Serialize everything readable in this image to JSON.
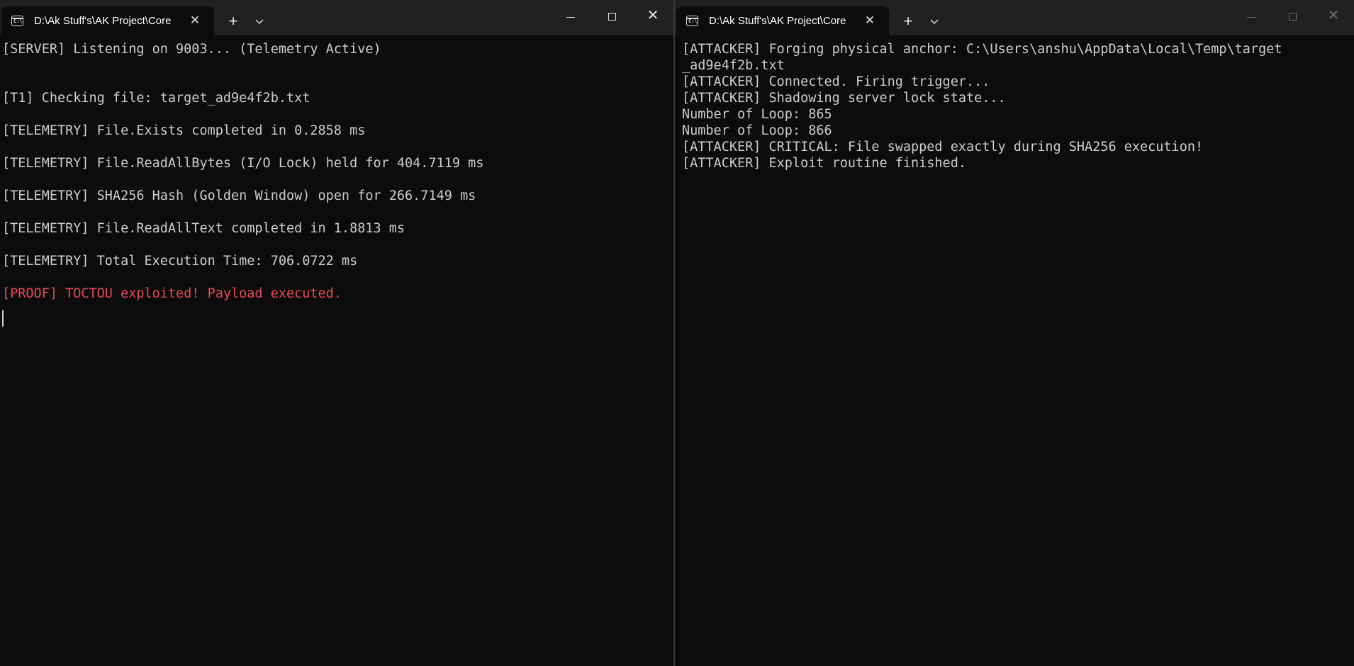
{
  "left_window": {
    "tab_title": "D:\\Ak Stuff's\\AK Project\\Core",
    "tab_close": "✕",
    "new_tab": "+",
    "dropdown": "⌄",
    "lines": [
      "[SERVER] Listening on 9003... (Telemetry Active)",
      "",
      "[T1] Checking file: target_ad9e4f2b.txt",
      "[TELEMETRY] File.Exists completed in 0.2858 ms",
      "[TELEMETRY] File.ReadAllBytes (I/O Lock) held for 404.7119 ms",
      "[TELEMETRY] SHA256 Hash (Golden Window) open for 266.7149 ms",
      "[TELEMETRY] File.ReadAllText completed in 1.8813 ms",
      "[TELEMETRY] Total Execution Time: 706.0722 ms",
      "[PROOF] TOCTOU exploited! Payload executed."
    ]
  },
  "right_window": {
    "tab_title": "D:\\Ak Stuff's\\AK Project\\Core",
    "tab_close": "✕",
    "new_tab": "+",
    "dropdown": "⌄",
    "lines": [
      "[ATTACKER] Forging physical anchor: C:\\Users\\anshu\\AppData\\Local\\Temp\\target",
      "_ad9e4f2b.txt",
      "[ATTACKER] Connected. Firing trigger...",
      "[ATTACKER] Shadowing server lock state...",
      "Number of Loop: 865",
      "Number of Loop: 866",
      "[ATTACKER] CRITICAL: File swapped exactly during SHA256 execution!",
      "[ATTACKER] Exploit routine finished."
    ]
  },
  "colors": {
    "background": "#0c0c0c",
    "titlebar": "#202020",
    "text": "#cccccc",
    "error_text": "#e74856"
  },
  "window_controls": {
    "close": "✕"
  }
}
